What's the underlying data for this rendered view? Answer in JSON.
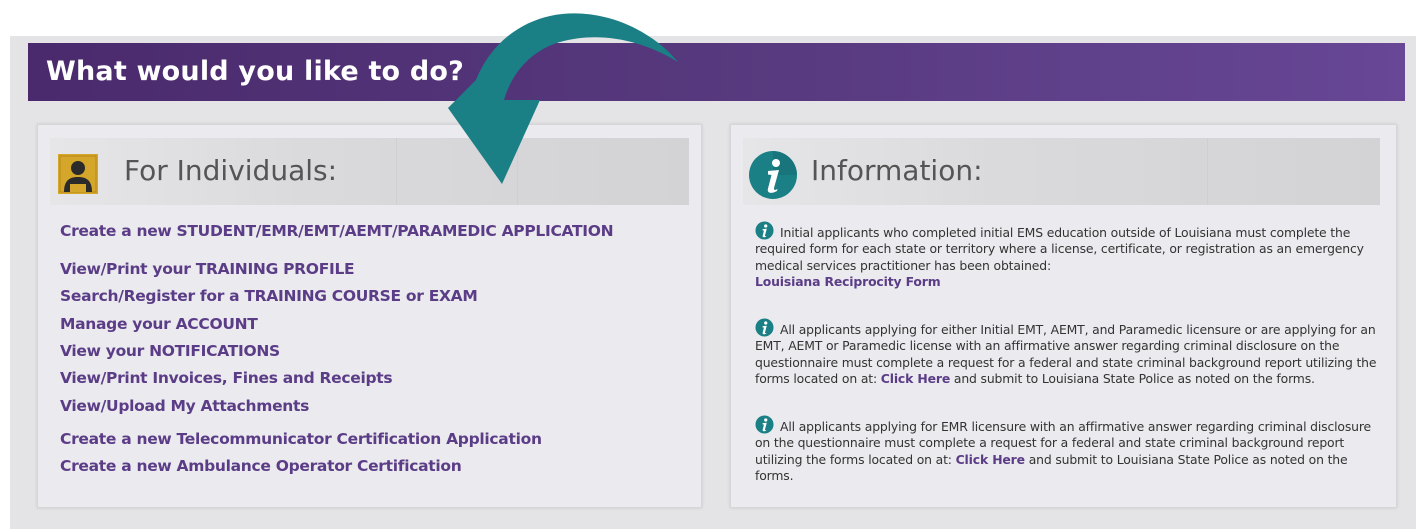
{
  "header": {
    "title": "What would you like to do?"
  },
  "individuals": {
    "title": "For Individuals:",
    "links": [
      "Create a new STUDENT/EMR/EMT/AEMT/PARAMEDIC APPLICATION",
      "View/Print your TRAINING PROFILE",
      "Search/Register for a TRAINING COURSE or EXAM",
      "Manage your ACCOUNT",
      "View your NOTIFICATIONS",
      "View/Print Invoices, Fines and Receipts",
      "View/Upload My Attachments",
      "Create a new Telecommunicator Certification Application",
      "Create a new Ambulance Operator Certification"
    ]
  },
  "information": {
    "title": "Information:",
    "block1": {
      "text": "Initial applicants who completed initial EMS education outside of Louisiana must complete the required form for each state or territory where a license, certificate, or registration as an emergency medical services practitioner has been obtained:",
      "link": "Louisiana Reciprocity Form"
    },
    "block2": {
      "pre": "All applicants applying for either Initial EMT, AEMT, and Paramedic licensure or are applying for an EMT, AEMT or Paramedic license with an affirmative answer regarding criminal disclosure on the questionnaire must complete a request for a federal and state criminal background report utilizing the forms located on at:",
      "link": "Click Here",
      "post": "and submit to Louisiana State Police as noted on the forms."
    },
    "block3": {
      "pre": "All applicants applying for EMR licensure with an affirmative answer regarding criminal disclosure on the questionnaire must complete a request for a federal and state criminal background report utilizing the forms located on at:",
      "link": "Click Here",
      "post": "and submit to Louisiana State Police as noted on the forms."
    }
  },
  "colors": {
    "header_start": "#4a2a6c",
    "header_end": "#674796",
    "link": "#5b3d87",
    "arrow": "#1b7f86",
    "info_icon": "#1b7f86",
    "person_icon": "#d4a62a"
  }
}
